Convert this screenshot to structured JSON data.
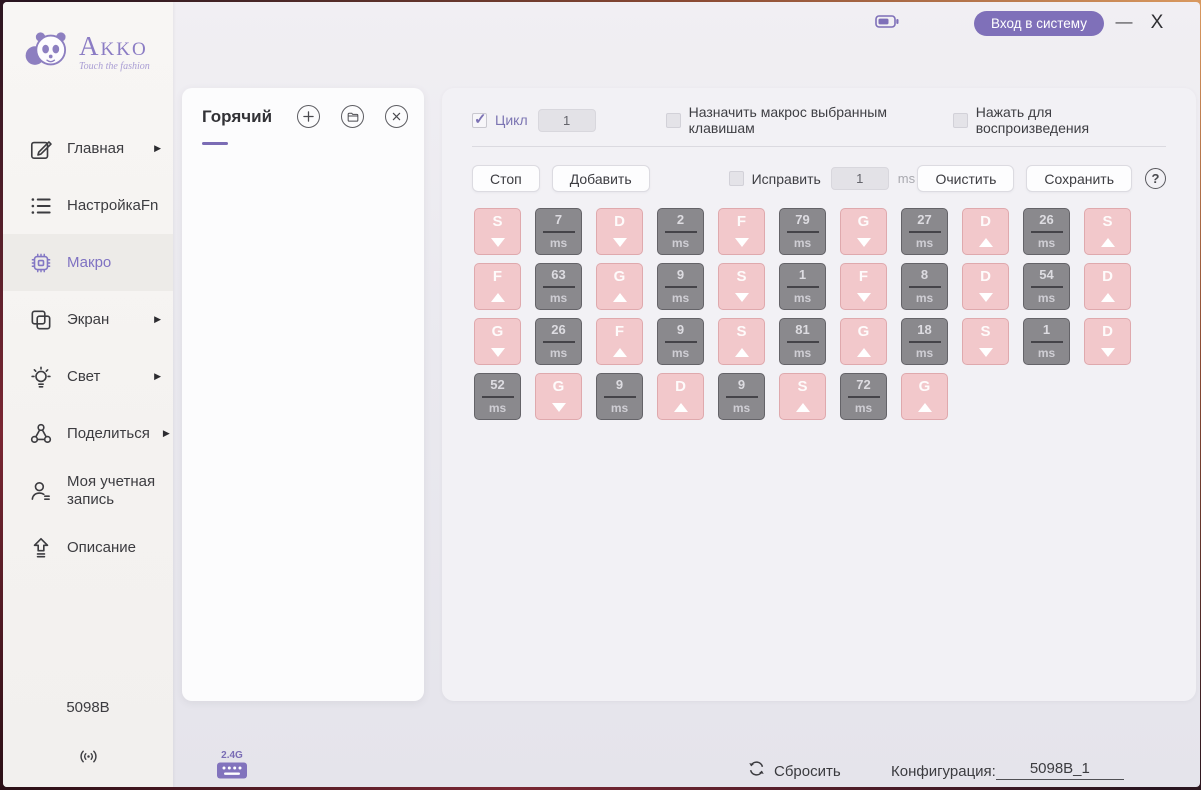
{
  "colors": {
    "accent": "#7f70b9",
    "key_pink": "#f2c8cb",
    "delay_gray": "#8a898d"
  },
  "titlebar": {
    "battery_icon": "battery-icon",
    "login_label": "Вход в систему",
    "minimize_label": "—",
    "close_label": "X"
  },
  "sidebar": {
    "brand": {
      "name": "Akko",
      "tagline": "Touch the fashion"
    },
    "items": [
      {
        "id": "home",
        "label": "Главная",
        "icon": "pencil-icon",
        "arrow": true,
        "selected": false
      },
      {
        "id": "fn",
        "label": "НастройкаFn",
        "icon": "list-icon",
        "arrow": false,
        "selected": false
      },
      {
        "id": "macro",
        "label": "Макро",
        "icon": "chip-icon",
        "arrow": false,
        "selected": true
      },
      {
        "id": "screen",
        "label": "Экран",
        "icon": "screens-icon",
        "arrow": true,
        "selected": false
      },
      {
        "id": "light",
        "label": "Свет",
        "icon": "bulb-icon",
        "arrow": true,
        "selected": false
      },
      {
        "id": "share",
        "label": "Поделиться",
        "icon": "share-icon",
        "arrow": true,
        "selected": false
      },
      {
        "id": "account",
        "label": "Моя учетная запись",
        "icon": "user-icon",
        "arrow": false,
        "selected": false
      },
      {
        "id": "about",
        "label": "Описание",
        "icon": "upload-icon",
        "arrow": false,
        "selected": false
      }
    ],
    "device_model": "5098B",
    "wireless_icon": "wireless-signal-icon"
  },
  "hot_panel": {
    "title": "Горячий",
    "icons": [
      "plus-circle-icon",
      "folder-circle-icon",
      "close-circle-icon"
    ]
  },
  "macro_editor": {
    "cycle_label": "Цикл",
    "cycle_checked": true,
    "cycle_value": "1",
    "assign_label": "Назначить макрос выбранным клавишам",
    "assign_checked": false,
    "play_label": "Нажать для воспроизведения",
    "play_checked": false,
    "stop_label": "Стоп",
    "add_label": "Добавить",
    "fix_label": "Исправить",
    "fix_checked": false,
    "fix_value": "1",
    "fix_unit": "ms",
    "clear_label": "Очистить",
    "save_label": "Сохранить",
    "help_label": "?",
    "delay_unit": "ms",
    "events": [
      {
        "t": "key",
        "k": "S",
        "d": "down"
      },
      {
        "t": "delay",
        "v": "7"
      },
      {
        "t": "key",
        "k": "D",
        "d": "down"
      },
      {
        "t": "delay",
        "v": "2"
      },
      {
        "t": "key",
        "k": "F",
        "d": "down"
      },
      {
        "t": "delay",
        "v": "79"
      },
      {
        "t": "key",
        "k": "G",
        "d": "down"
      },
      {
        "t": "delay",
        "v": "27"
      },
      {
        "t": "key",
        "k": "D",
        "d": "up"
      },
      {
        "t": "delay",
        "v": "26"
      },
      {
        "t": "key",
        "k": "S",
        "d": "up"
      },
      {
        "t": "key",
        "k": "F",
        "d": "up"
      },
      {
        "t": "delay",
        "v": "63"
      },
      {
        "t": "key",
        "k": "G",
        "d": "up"
      },
      {
        "t": "delay",
        "v": "9"
      },
      {
        "t": "key",
        "k": "S",
        "d": "down"
      },
      {
        "t": "delay",
        "v": "1"
      },
      {
        "t": "key",
        "k": "F",
        "d": "down"
      },
      {
        "t": "delay",
        "v": "8"
      },
      {
        "t": "key",
        "k": "D",
        "d": "down"
      },
      {
        "t": "delay",
        "v": "54"
      },
      {
        "t": "key",
        "k": "D",
        "d": "up"
      },
      {
        "t": "key",
        "k": "G",
        "d": "down"
      },
      {
        "t": "delay",
        "v": "26"
      },
      {
        "t": "key",
        "k": "F",
        "d": "up"
      },
      {
        "t": "delay",
        "v": "9"
      },
      {
        "t": "key",
        "k": "S",
        "d": "up"
      },
      {
        "t": "delay",
        "v": "81"
      },
      {
        "t": "key",
        "k": "G",
        "d": "up"
      },
      {
        "t": "delay",
        "v": "18"
      },
      {
        "t": "key",
        "k": "S",
        "d": "down"
      },
      {
        "t": "delay",
        "v": "1"
      },
      {
        "t": "key",
        "k": "D",
        "d": "down"
      },
      {
        "t": "delay",
        "v": "52"
      },
      {
        "t": "key",
        "k": "G",
        "d": "down"
      },
      {
        "t": "delay",
        "v": "9"
      },
      {
        "t": "key",
        "k": "D",
        "d": "up"
      },
      {
        "t": "delay",
        "v": "9"
      },
      {
        "t": "key",
        "k": "S",
        "d": "up"
      },
      {
        "t": "delay",
        "v": "72"
      },
      {
        "t": "key",
        "k": "G",
        "d": "up"
      }
    ]
  },
  "footer": {
    "connection_label": "2.4G",
    "reset_label": "Сбросить",
    "config_label": "Конфигурация:",
    "config_value": "5098B_1"
  }
}
